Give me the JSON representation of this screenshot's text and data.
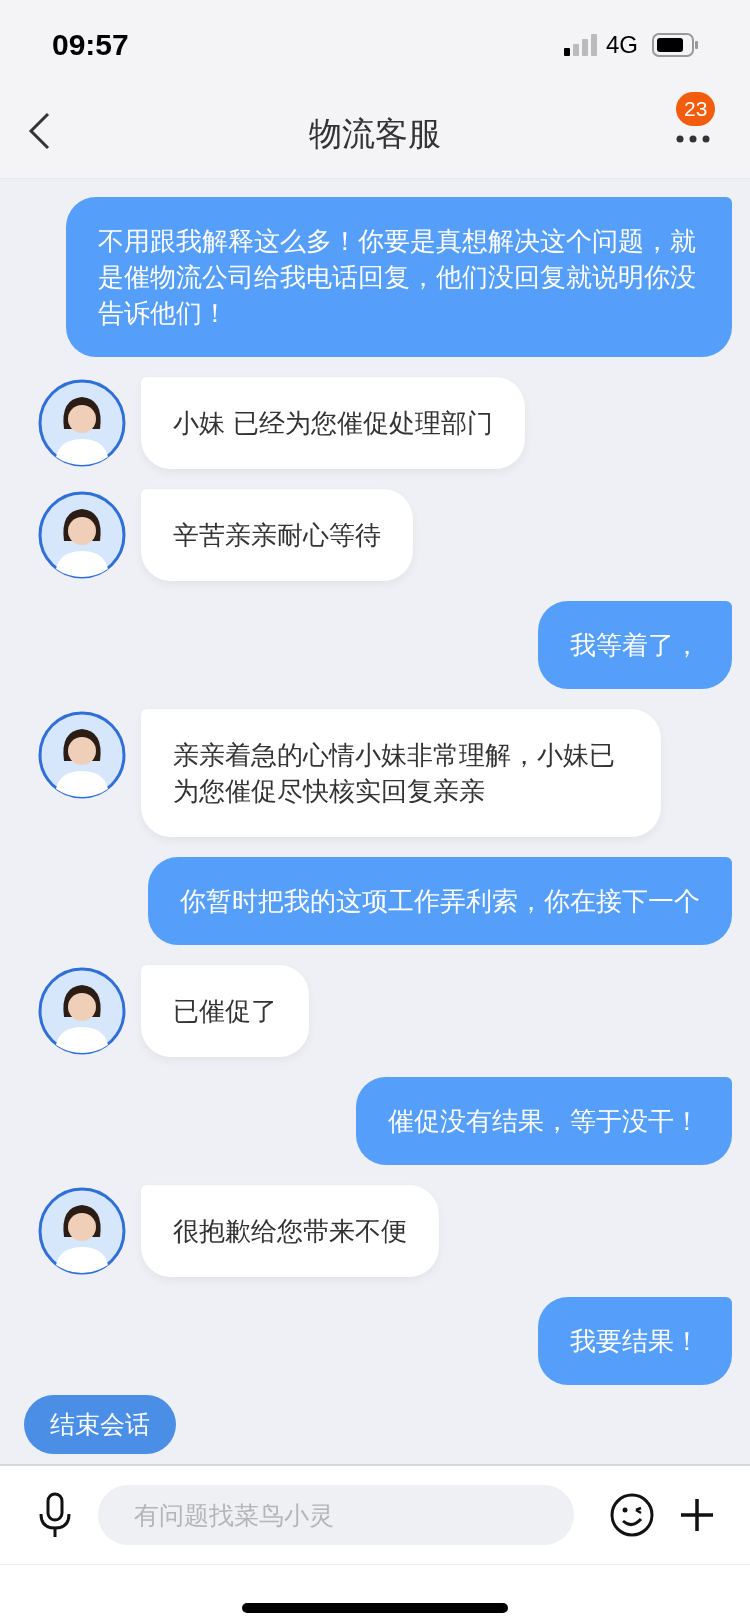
{
  "status_bar": {
    "time": "09:57",
    "network": "4G"
  },
  "header": {
    "title": "物流客服",
    "badge": "23"
  },
  "messages": [
    {
      "kind": "outgoing",
      "text": "不用跟我解释这么多！你要是真想解决这个问题，就是催物流公司给我电话回复，他们没回复就说明你没告诉他们！"
    },
    {
      "kind": "incoming",
      "text": "小妹 已经为您催促处理部门"
    },
    {
      "kind": "incoming",
      "text": "辛苦亲亲耐心等待"
    },
    {
      "kind": "outgoing",
      "text": "我等着了，"
    },
    {
      "kind": "incoming",
      "text": "亲亲着急的心情小妹非常理解，小妹已为您催促尽快核实回复亲亲"
    },
    {
      "kind": "outgoing",
      "text": "你暂时把我的这项工作弄利索，你在接下一个"
    },
    {
      "kind": "incoming",
      "text": "已催促了"
    },
    {
      "kind": "outgoing",
      "text": "催促没有结果，等于没干！"
    },
    {
      "kind": "incoming",
      "text": "很抱歉给您带来不便"
    },
    {
      "kind": "outgoing",
      "text": "我要结果！"
    }
  ],
  "end_button": "结束会话",
  "input": {
    "placeholder": "有问题找菜鸟小灵"
  }
}
